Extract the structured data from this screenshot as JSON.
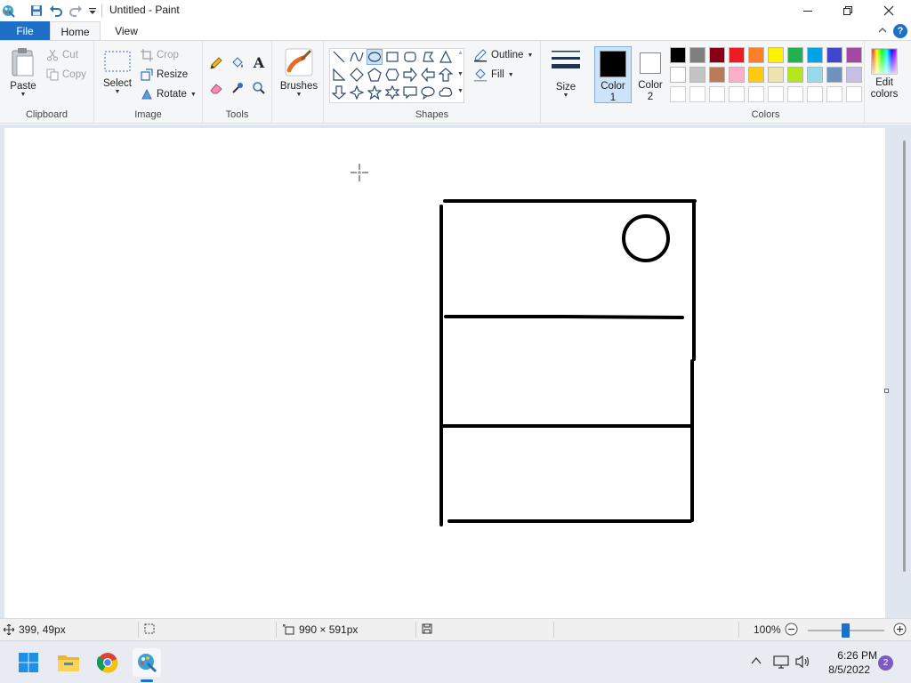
{
  "window": {
    "title": "Untitled - Paint"
  },
  "tabs": {
    "file": "File",
    "home": "Home",
    "view": "View"
  },
  "ribbon": {
    "clipboard": {
      "label": "Clipboard",
      "paste": "Paste",
      "cut": "Cut",
      "copy": "Copy"
    },
    "image": {
      "label": "Image",
      "select": "Select",
      "crop": "Crop",
      "resize": "Resize",
      "rotate": "Rotate"
    },
    "tools": {
      "label": "Tools"
    },
    "brushes": {
      "label": "Brushes"
    },
    "shapes": {
      "label": "Shapes",
      "outline": "Outline",
      "fill": "Fill"
    },
    "size": {
      "label": "Size"
    },
    "color1": {
      "line1": "Color",
      "line2": "1",
      "value": "#000000"
    },
    "color2": {
      "line1": "Color",
      "line2": "2",
      "value": "#ffffff"
    },
    "colors": {
      "label": "Colors",
      "row1": [
        "#000000",
        "#7f7f7f",
        "#880015",
        "#ed1c24",
        "#ff7f27",
        "#fff200",
        "#22b14c",
        "#00a2e8",
        "#3f48cc",
        "#a349a4"
      ],
      "row2": [
        "#ffffff",
        "#c3c3c3",
        "#b97a57",
        "#ffaec9",
        "#ffc90e",
        "#efe4b0",
        "#b5e61d",
        "#99d9ea",
        "#7092be",
        "#c8bfe7"
      ],
      "row3": [
        "#ffffff",
        "#ffffff",
        "#ffffff",
        "#ffffff",
        "#ffffff",
        "#ffffff",
        "#ffffff",
        "#ffffff",
        "#ffffff",
        "#ffffff"
      ]
    },
    "edit_colors": {
      "line1": "Edit",
      "line2": "colors"
    }
  },
  "status": {
    "cursor_pos": "399, 49px",
    "canvas_size": "990 × 591px",
    "zoom": "100%"
  },
  "taskbar": {
    "time": "6:26 PM",
    "date": "8/5/2022",
    "notifications": "2"
  }
}
